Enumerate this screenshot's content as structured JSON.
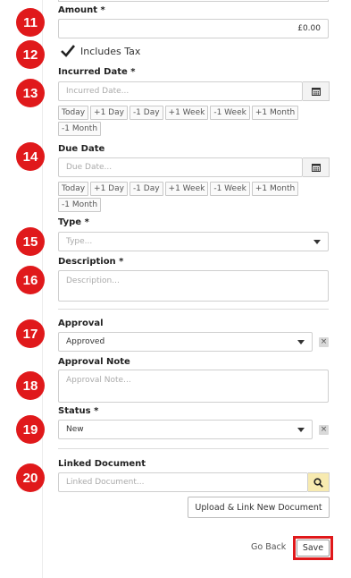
{
  "amount": {
    "label": "Amount *",
    "value": "£0.00"
  },
  "includes_tax": {
    "label": "Includes Tax",
    "checked": true
  },
  "incurred_date": {
    "label": "Incurred Date *",
    "placeholder": "Incurred Date...",
    "quick_buttons": [
      "Today",
      "+1 Day",
      "-1 Day",
      "+1 Week",
      "-1 Week",
      "+1 Month",
      "-1 Month"
    ]
  },
  "due_date": {
    "label": "Due Date",
    "placeholder": "Due Date...",
    "quick_buttons": [
      "Today",
      "+1 Day",
      "-1 Day",
      "+1 Week",
      "-1 Week",
      "+1 Month",
      "-1 Month"
    ]
  },
  "type": {
    "label": "Type *",
    "placeholder": "Type..."
  },
  "description": {
    "label": "Description *",
    "placeholder": "Description..."
  },
  "approval": {
    "label": "Approval",
    "value": "Approved",
    "clear": "×"
  },
  "approval_note": {
    "label": "Approval Note",
    "placeholder": "Approval Note..."
  },
  "status": {
    "label": "Status *",
    "value": "New",
    "clear": "×"
  },
  "linked_document": {
    "label": "Linked Document",
    "placeholder": "Linked Document...",
    "upload_label": "Upload & Link New Document"
  },
  "actions": {
    "go_back": "Go Back",
    "save": "Save"
  },
  "badges": [
    "11",
    "12",
    "13",
    "14",
    "15",
    "16",
    "17",
    "18",
    "19",
    "20"
  ],
  "colors": {
    "badge": "#e0191b",
    "highlight": "#e0191b",
    "search_addon": "#f7eab0"
  }
}
